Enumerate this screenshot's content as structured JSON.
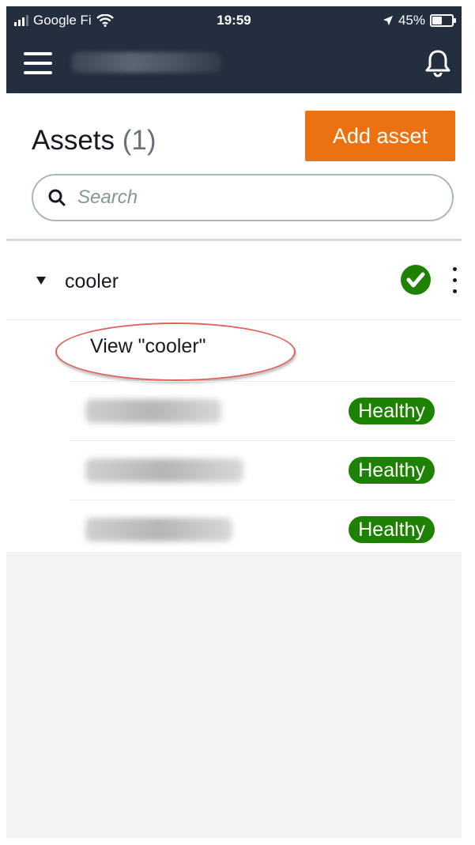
{
  "status_bar": {
    "carrier": "Google Fi",
    "time": "19:59",
    "battery": "45%"
  },
  "header": {
    "menu_icon": "hamburger-menu-icon",
    "notification_icon": "bell-icon"
  },
  "assets": {
    "title": "Assets",
    "count": "(1)",
    "add_button_label": "Add asset",
    "search_placeholder": "Search"
  },
  "tree": {
    "node_label": "cooler",
    "status_icon": "check-circle-icon",
    "view_link": "View \"cooler\"",
    "children": [
      {
        "status": "Healthy"
      },
      {
        "status": "Healthy"
      },
      {
        "status": "Healthy"
      }
    ]
  },
  "colors": {
    "header_bg": "#232f3e",
    "accent": "#ec7211",
    "healthy": "#1d8102",
    "annotation": "#e0605c"
  }
}
